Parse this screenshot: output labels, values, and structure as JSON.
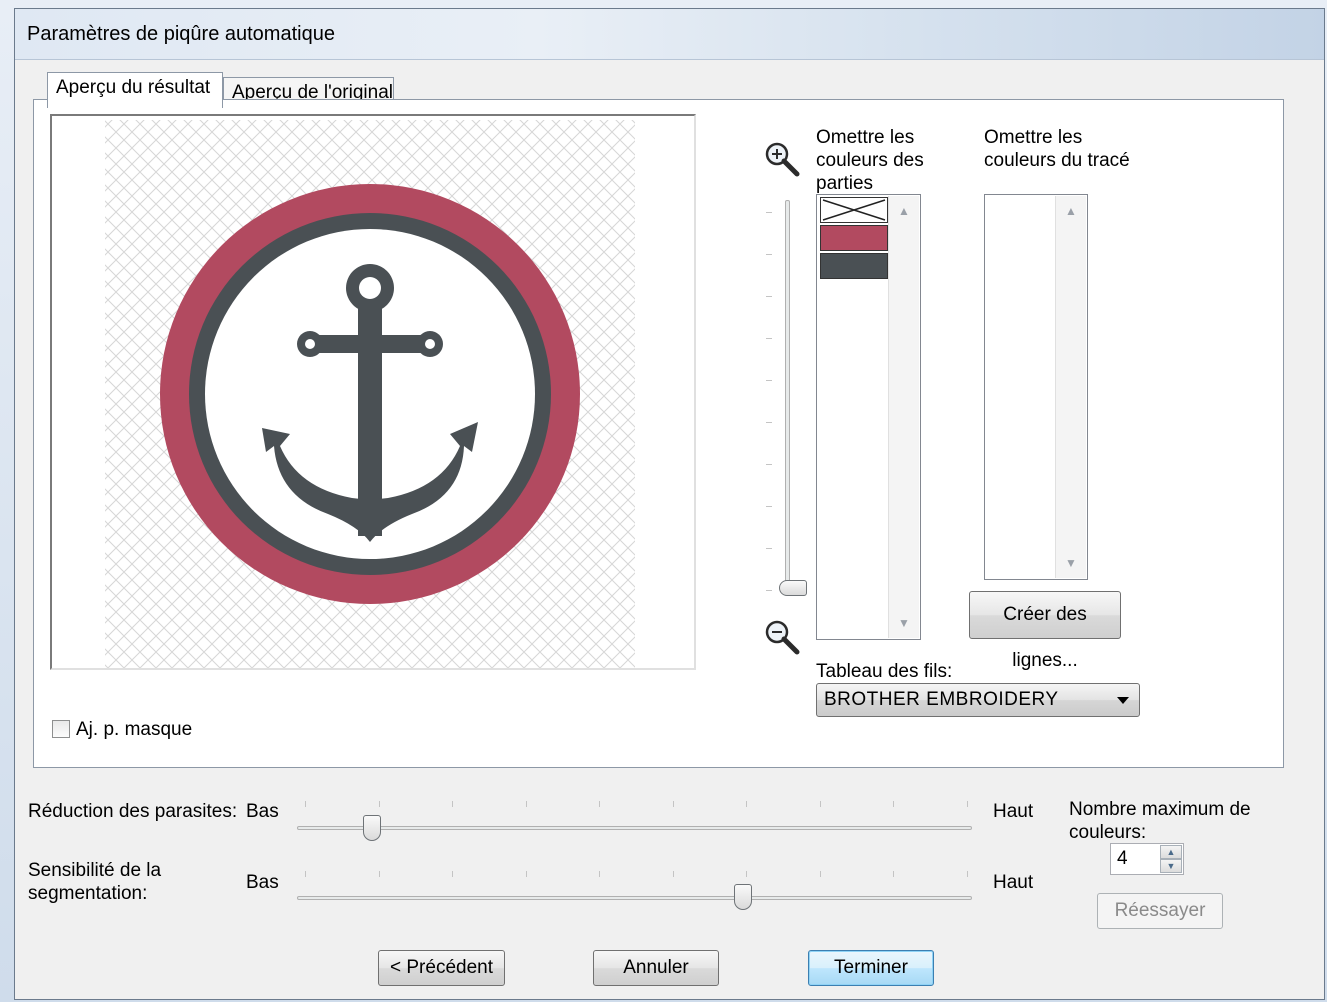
{
  "window": {
    "title": "Paramètres de piqûre automatique"
  },
  "tabs": [
    {
      "label": "Aperçu du résultat",
      "active": true
    },
    {
      "label": "Aperçu de l'original",
      "active": false
    }
  ],
  "preview": {
    "mask_checkbox_label": "Aj. p. masque",
    "mask_checked": false
  },
  "zoom": {
    "zoom_in_icon": "zoom-in-icon",
    "zoom_out_icon": "zoom-out-icon",
    "level_fraction": 0.0
  },
  "omit_parts": {
    "heading": "Omettre les couleurs des parties",
    "heading_lines": [
      "Omettre les",
      "couleurs des",
      "parties"
    ],
    "swatches": [
      {
        "name": "no-color",
        "color": "#ffffff"
      },
      {
        "name": "red",
        "color": "#b24a60"
      },
      {
        "name": "dark-gray",
        "color": "#4a5054"
      }
    ]
  },
  "omit_outline": {
    "heading_lines": [
      "Omettre les",
      "couleurs du tracé"
    ],
    "create_lines_button": "Créer des lignes..."
  },
  "thread_table": {
    "label": "Tableau des fils:",
    "selected": "BROTHER EMBROIDERY"
  },
  "noise_reduction": {
    "label": "Réduction des parasites:",
    "low": "Bas",
    "high": "Haut",
    "value_fraction": 0.11
  },
  "segmentation": {
    "label_lines": [
      "Sensibilité de la",
      "segmentation:"
    ],
    "low": "Bas",
    "high": "Haut",
    "value_fraction": 0.67
  },
  "max_colors": {
    "label_lines": [
      "Nombre maximum de",
      "couleurs:"
    ],
    "value": "4",
    "retry_button": "Réessayer"
  },
  "footer": {
    "prev_button": "< Précédent",
    "cancel_button": "Annuler",
    "finish_button": "Terminer"
  },
  "colors": {
    "ring": "#b24a60",
    "anchor": "#4a5054",
    "accent": "#3c7fb1"
  }
}
